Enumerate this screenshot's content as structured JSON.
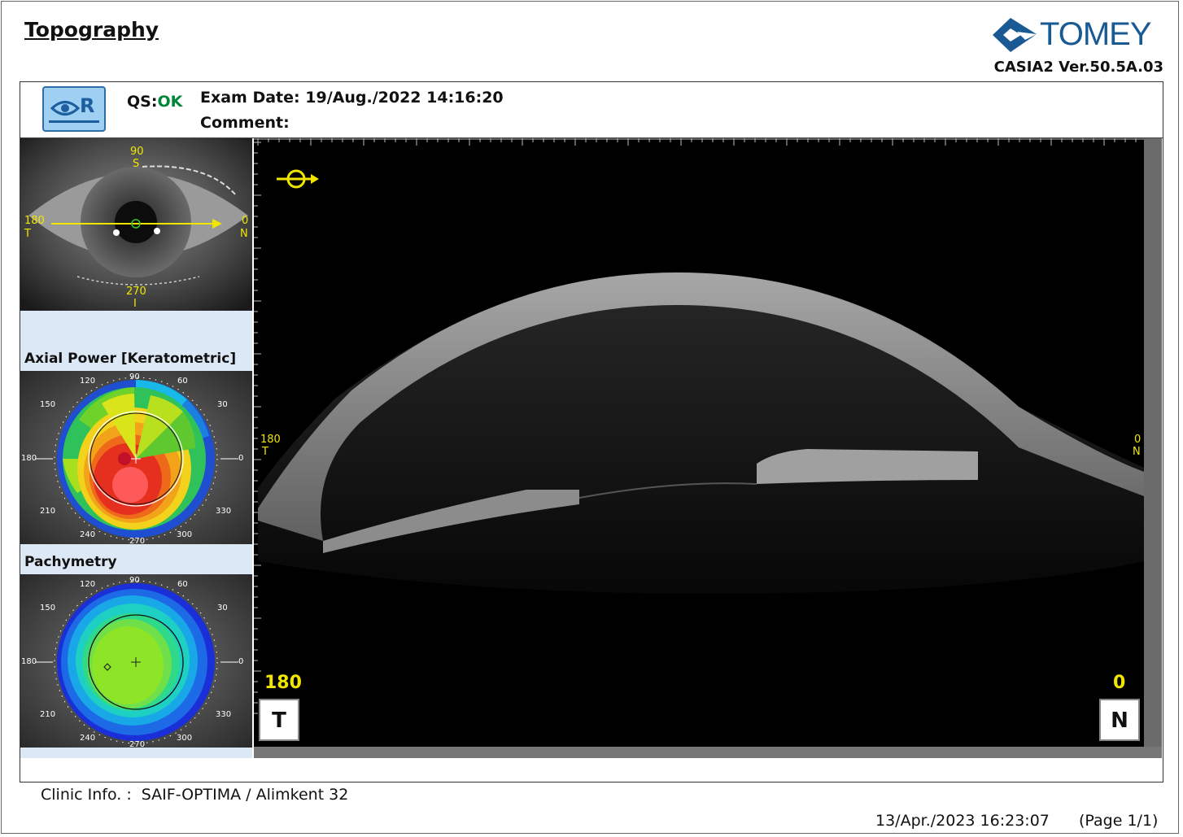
{
  "header": {
    "title": "Topography",
    "brand": "TOMEY",
    "version": "CASIA2 Ver.50.5A.03"
  },
  "exam": {
    "eye": "R",
    "qs_label": "QS:",
    "qs_value": "OK",
    "exam_date_label": "Exam Date:",
    "exam_date_value": "19/Aug./2022 14:16:20",
    "comment_label": "Comment:",
    "comment_value": ""
  },
  "eye_photo": {
    "top_angle": "90",
    "top_dir": "S",
    "left_angle": "180",
    "left_dir": "T",
    "right_angle": "0",
    "right_dir": "N",
    "bottom_angle": "270",
    "bottom_dir": "I"
  },
  "axial_map": {
    "label": "Axial Power [Keratometric]",
    "angles": [
      "120",
      "90",
      "60",
      "150",
      "30",
      "180",
      "0",
      "210",
      "330",
      "240",
      "270",
      "300"
    ]
  },
  "pachy_map": {
    "label": "Pachymetry",
    "angles": [
      "120",
      "90",
      "60",
      "150",
      "30",
      "180",
      "0",
      "210",
      "330",
      "240",
      "270",
      "300"
    ]
  },
  "oct": {
    "left_angle": "180",
    "left_dir": "T",
    "right_angle": "0",
    "right_dir": "N",
    "bottom_left_angle": "180",
    "bottom_left_dir": "T",
    "bottom_right_angle": "0",
    "bottom_right_dir": "N"
  },
  "footer": {
    "clinic_label": "Clinic Info. :",
    "clinic_value": "SAIF-OPTIMA / Alimkent 32",
    "printed": "13/Apr./2023 16:23:07",
    "page": "(Page 1/1)"
  },
  "colors": {
    "brand": "#1a5a94",
    "qs_ok": "#00853a",
    "marker_yellow": "#f2e600"
  }
}
